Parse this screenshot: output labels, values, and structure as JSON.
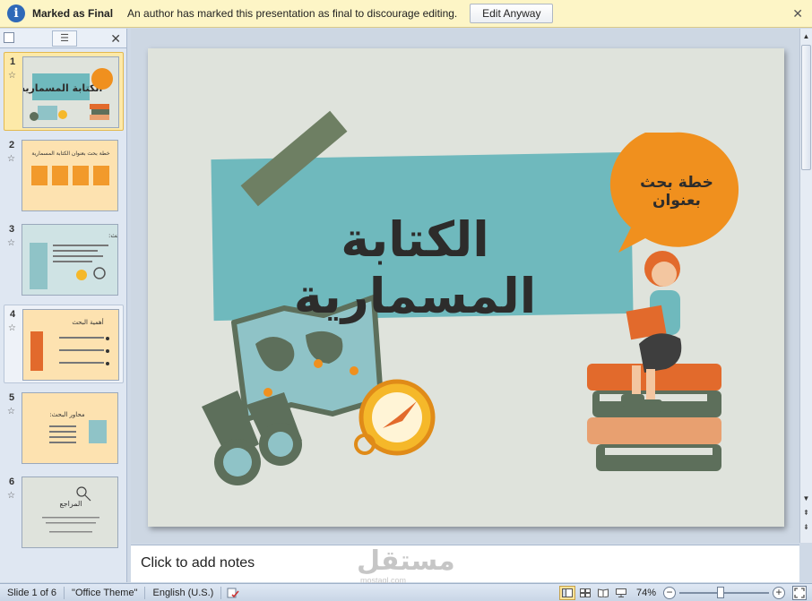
{
  "message_bar": {
    "title": "Marked as Final",
    "text": "An author has marked this presentation as final to discourage editing.",
    "button": "Edit Anyway"
  },
  "panel": {
    "slides": [
      {
        "number": "1",
        "selected": true,
        "title": "الكتابة المسمارية"
      },
      {
        "number": "2",
        "title": "خطة بحث بعنوان الكتابة المسمارية"
      },
      {
        "number": "3",
        "title": "أهداف البحث:"
      },
      {
        "number": "4",
        "title": "أهمية البحث"
      },
      {
        "number": "5",
        "title": "محاور البحث:"
      },
      {
        "number": "6",
        "title": "المراجع"
      }
    ]
  },
  "slide": {
    "title": "الكتابة المسمارية",
    "subtitle": "خطة بحث بعنوان",
    "colors": {
      "background": "#dfe3dc",
      "banner": "#6fb9bd",
      "accent": "#f0901e",
      "tape": "#6e7f63"
    }
  },
  "notes": {
    "placeholder": "Click to add notes",
    "watermark": "مستقل",
    "watermark_sub": "mostaql.com"
  },
  "status": {
    "slide_info": "Slide 1 of 6",
    "theme": "\"Office Theme\"",
    "language": "English (U.S.)",
    "zoom": "74%",
    "zoom_percent": 74
  }
}
